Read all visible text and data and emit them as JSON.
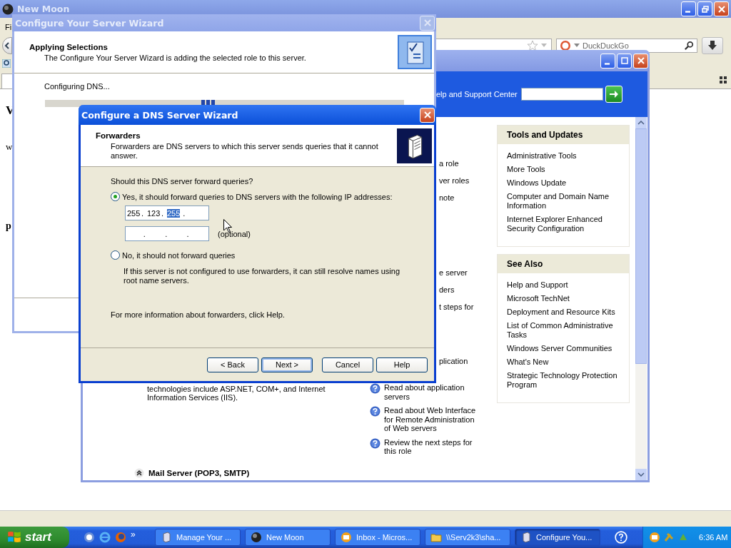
{
  "browser": {
    "title": "New Moon",
    "menu_fragment": "Fi",
    "search_placeholder": "DuckDuckGo",
    "page_fragments": [
      "V",
      "w",
      "p"
    ]
  },
  "manage_window": {
    "search_label": "elp and Support Center",
    "role_fragments": [
      [
        "a role",
        "ver roles",
        "note"
      ],
      [
        "e server",
        "ders",
        "t steps for"
      ],
      [
        "plication"
      ]
    ],
    "role_description": "technologies include ASP.NET, COM+, and Internet Information Services (IIS).",
    "help_links": [
      "Read about application servers",
      "Read about Web Interface for Remote Administration of Web servers",
      "Review the next steps for this role"
    ],
    "next_role": "Mail Server (POP3, SMTP)",
    "panels": [
      {
        "title": "Tools and Updates",
        "items": [
          "Administrative Tools",
          "More Tools",
          "Windows Update",
          "Computer and Domain Name Information",
          "Internet Explorer Enhanced Security Configuration"
        ]
      },
      {
        "title": "See Also",
        "items": [
          "Help and Support",
          "Microsoft TechNet",
          "Deployment and Resource Kits",
          "List of Common Administrative Tasks",
          "Windows Server Communities",
          "What's New",
          "Strategic Technology Protection Program"
        ]
      }
    ]
  },
  "server_wizard": {
    "title": "Configure Your Server Wizard",
    "heading": "Applying Selections",
    "subheading": "The Configure Your Server Wizard is adding the selected role to this server.",
    "status": "Configuring DNS...",
    "progress": {
      "indeterminate": true
    }
  },
  "dns_wizard": {
    "title": "Configure a DNS Server Wizard",
    "heading": "Forwarders",
    "description": "Forwarders are DNS servers to which this server sends queries that it cannot answer.",
    "question": "Should this DNS server forward queries?",
    "options": [
      {
        "label": "Yes, it should forward queries to DNS servers with the following IP addresses:",
        "selected": true
      },
      {
        "label": "No, it should not forward queries",
        "selected": false
      }
    ],
    "separator": ".",
    "ip_fields": [
      {
        "octets": [
          {
            "text": "255",
            "selected": false
          },
          {
            "text": "123",
            "selected": false
          },
          {
            "text": "255",
            "selected": true
          }
        ]
      },
      {
        "hint": "(optional)"
      }
    ],
    "no_note": "If this server is not configured to use forwarders, it can still resolve names using root name servers.",
    "help_note": "For more information about forwarders, click Help.",
    "buttons": [
      {
        "label": "< Back",
        "default": false
      },
      {
        "label": "Next >",
        "default": true
      },
      {
        "label": "Cancel",
        "default": false
      },
      {
        "label": "Help",
        "default": false
      }
    ]
  },
  "taskbar": {
    "start": "start",
    "more": "»",
    "tasks": [
      {
        "label": "Manage Your ...",
        "kind": "server",
        "selected": false
      },
      {
        "label": "New Moon",
        "kind": "globe",
        "selected": false
      },
      {
        "label": "Inbox - Micros...",
        "kind": "mail",
        "selected": false
      },
      {
        "label": "\\\\Serv2k3\\sha...",
        "kind": "folder",
        "selected": false
      },
      {
        "label": "Configure You...",
        "kind": "server",
        "selected": true
      }
    ],
    "clock": "6:36 AM"
  }
}
